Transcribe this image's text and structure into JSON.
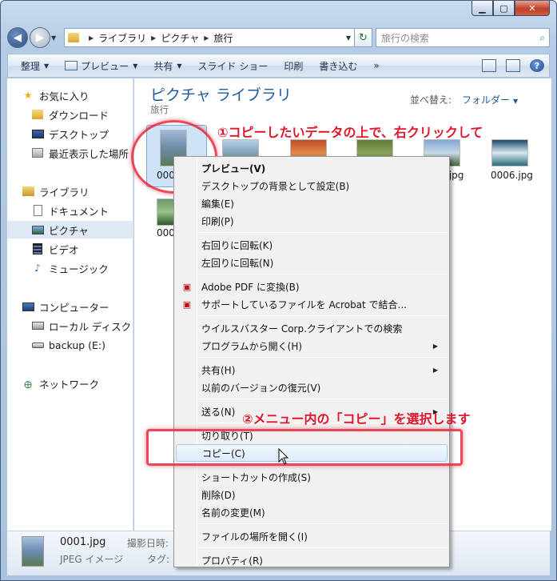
{
  "window": {
    "minimize_glyph": "▁",
    "maximize_glyph": "▢",
    "close_glyph": "✕"
  },
  "nav": {
    "back_glyph": "◀",
    "forward_glyph": "▶",
    "breadcrumb": [
      "ライブラリ",
      "ピクチャ",
      "旅行"
    ],
    "search_placeholder": "旅行の検索"
  },
  "toolbar": {
    "organize": "整理",
    "preview": "プレビュー",
    "share": "共有",
    "slideshow": "スライド ショー",
    "print": "印刷",
    "burn": "書き込む",
    "more": "»",
    "help": "?"
  },
  "sidebar": {
    "favorites": {
      "label": "お気に入り",
      "icon": "star-icon",
      "color": "#e8b21a"
    },
    "favorites_items": [
      {
        "label": "ダウンロード",
        "icon": "download-folder-icon"
      },
      {
        "label": "デスクトップ",
        "icon": "desktop-icon"
      },
      {
        "label": "最近表示した場所",
        "icon": "recent-places-icon"
      }
    ],
    "libraries": {
      "label": "ライブラリ",
      "icon": "library-icon"
    },
    "library_items": [
      {
        "label": "ドキュメント",
        "icon": "documents-icon"
      },
      {
        "label": "ピクチャ",
        "icon": "pictures-icon",
        "selected": true
      },
      {
        "label": "ビデオ",
        "icon": "videos-icon"
      },
      {
        "label": "ミュージック",
        "icon": "music-icon"
      }
    ],
    "computer": {
      "label": "コンピューター",
      "icon": "computer-icon"
    },
    "computer_items": [
      {
        "label": "ローカル ディスク (",
        "icon": "local-disk-icon"
      },
      {
        "label": "backup (E:)",
        "icon": "drive-icon"
      }
    ],
    "network": {
      "label": "ネットワーク",
      "icon": "network-icon"
    }
  },
  "content": {
    "title": "ピクチャ ライブラリ",
    "subtitle": "旅行",
    "arrange_label": "並べ替え:",
    "arrange_value": "フォルダー",
    "thumbnails": [
      {
        "label": "000",
        "colors": [
          "#9fb9d8",
          "#6f8ba6",
          "#5b7a58"
        ]
      },
      {
        "label": "",
        "colors": [
          "#b8d0e8",
          "#7ea0b8",
          "#6a8a4e"
        ]
      },
      {
        "label": "",
        "colors": [
          "#c14a2a",
          "#e08a4a",
          "#8a5a3a"
        ]
      },
      {
        "label": "",
        "colors": [
          "#5f7a3a",
          "#8aa25a",
          "#3d5a2a"
        ]
      },
      {
        "label": ".jpg",
        "colors": [
          "#7fa8d0",
          "#c8d8e8",
          "#4a6a3a"
        ]
      },
      {
        "label": "0006.jpg",
        "colors": [
          "#1e4a6a",
          "#d8e8f0",
          "#2a6a7a"
        ]
      },
      {
        "label": "000",
        "colors": [
          "#6a9a6a",
          "#9ac08a",
          "#2e5a2e"
        ]
      }
    ]
  },
  "context_menu": {
    "items": [
      {
        "label": "プレビュー(V)",
        "bold": true
      },
      {
        "label": "デスクトップの背景として設定(B)"
      },
      {
        "label": "編集(E)"
      },
      {
        "label": "印刷(P)"
      },
      {
        "sep": true
      },
      {
        "label": "右回りに回転(K)"
      },
      {
        "label": "左回りに回転(N)"
      },
      {
        "sep": true
      },
      {
        "label": "Adobe PDF に変換(B)",
        "icon": "pdf-icon"
      },
      {
        "label": "サポートしているファイルを Acrobat で結合...",
        "icon": "acrobat-combine-icon"
      },
      {
        "sep": true
      },
      {
        "label": "ウイルスバスター Corp.クライアントでの検索"
      },
      {
        "label": "プログラムから開く(H)",
        "submenu": true
      },
      {
        "sep": true
      },
      {
        "label": "共有(H)",
        "submenu": true
      },
      {
        "label": "以前のバージョンの復元(V)"
      },
      {
        "sep": true
      },
      {
        "label": "送る(N)",
        "submenu": true
      },
      {
        "sep": true
      },
      {
        "label": "切り取り(T)"
      },
      {
        "label": "コピー(C)",
        "highlighted": true
      },
      {
        "sep": true
      },
      {
        "label": "ショートカットの作成(S)"
      },
      {
        "label": "削除(D)"
      },
      {
        "label": "名前の変更(M)"
      },
      {
        "sep": true
      },
      {
        "label": "ファイルの場所を開く(I)"
      },
      {
        "sep": true
      },
      {
        "label": "プロパティ(R)"
      }
    ],
    "submenu_glyph": "▶"
  },
  "annotations": {
    "step1": "①コピーしたいデータの上で、右クリックして",
    "step2": "②メニュー内の「コピー」を選択します",
    "color": "#e0172c"
  },
  "details": {
    "filename": "0001.jpg",
    "filetype": "JPEG イメージ",
    "label1": "撮影日時:",
    "label2": "タグ:"
  }
}
